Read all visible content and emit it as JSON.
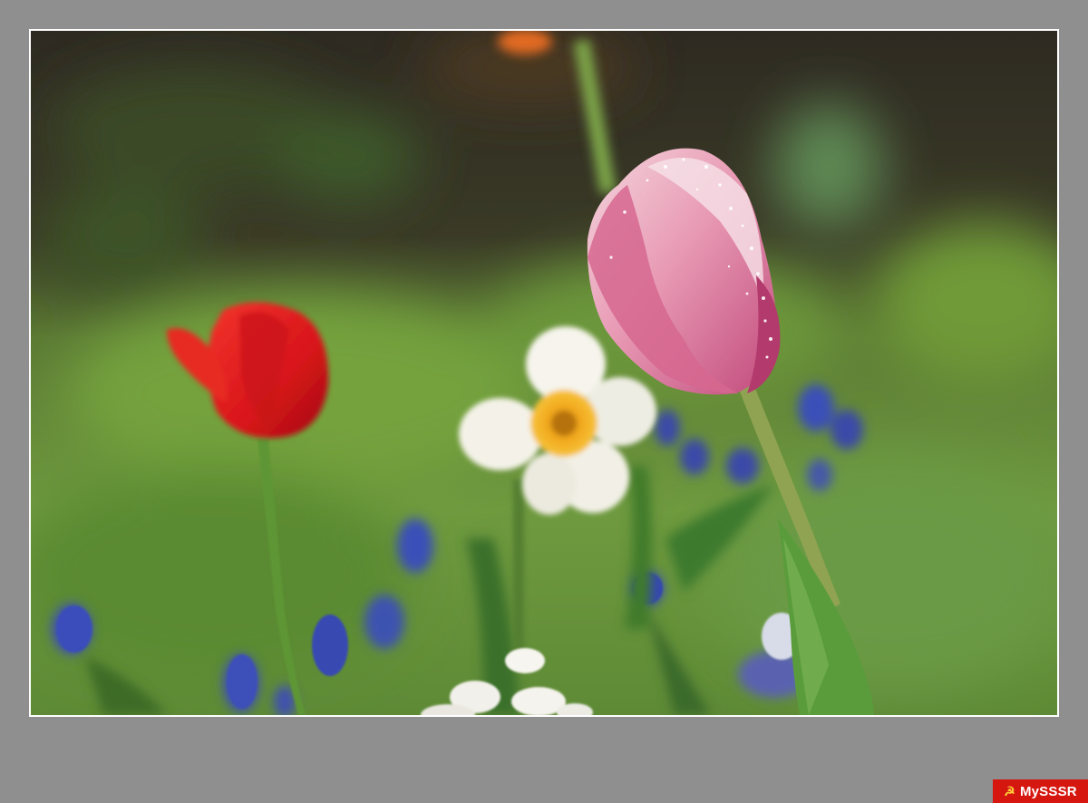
{
  "photo": {
    "subject": "flower-photo",
    "palette": {
      "background_dark": "#2b2620",
      "foliage_green": "#6e9a3c",
      "tulip_pink": "#e48aa8",
      "tulip_red": "#e0141a",
      "daffodil_white": "#f7f5ee",
      "daffodil_center": "#f0a61c",
      "muscari_blue": "#3a4fb8",
      "frame_border": "#ffffff",
      "page_background": "#8f8f8f"
    }
  },
  "watermark": {
    "text": "MySSSR",
    "emblem_icon": "hammer-and-sickle-icon",
    "emblem_glyph": "☭",
    "color": "#d6170f"
  }
}
